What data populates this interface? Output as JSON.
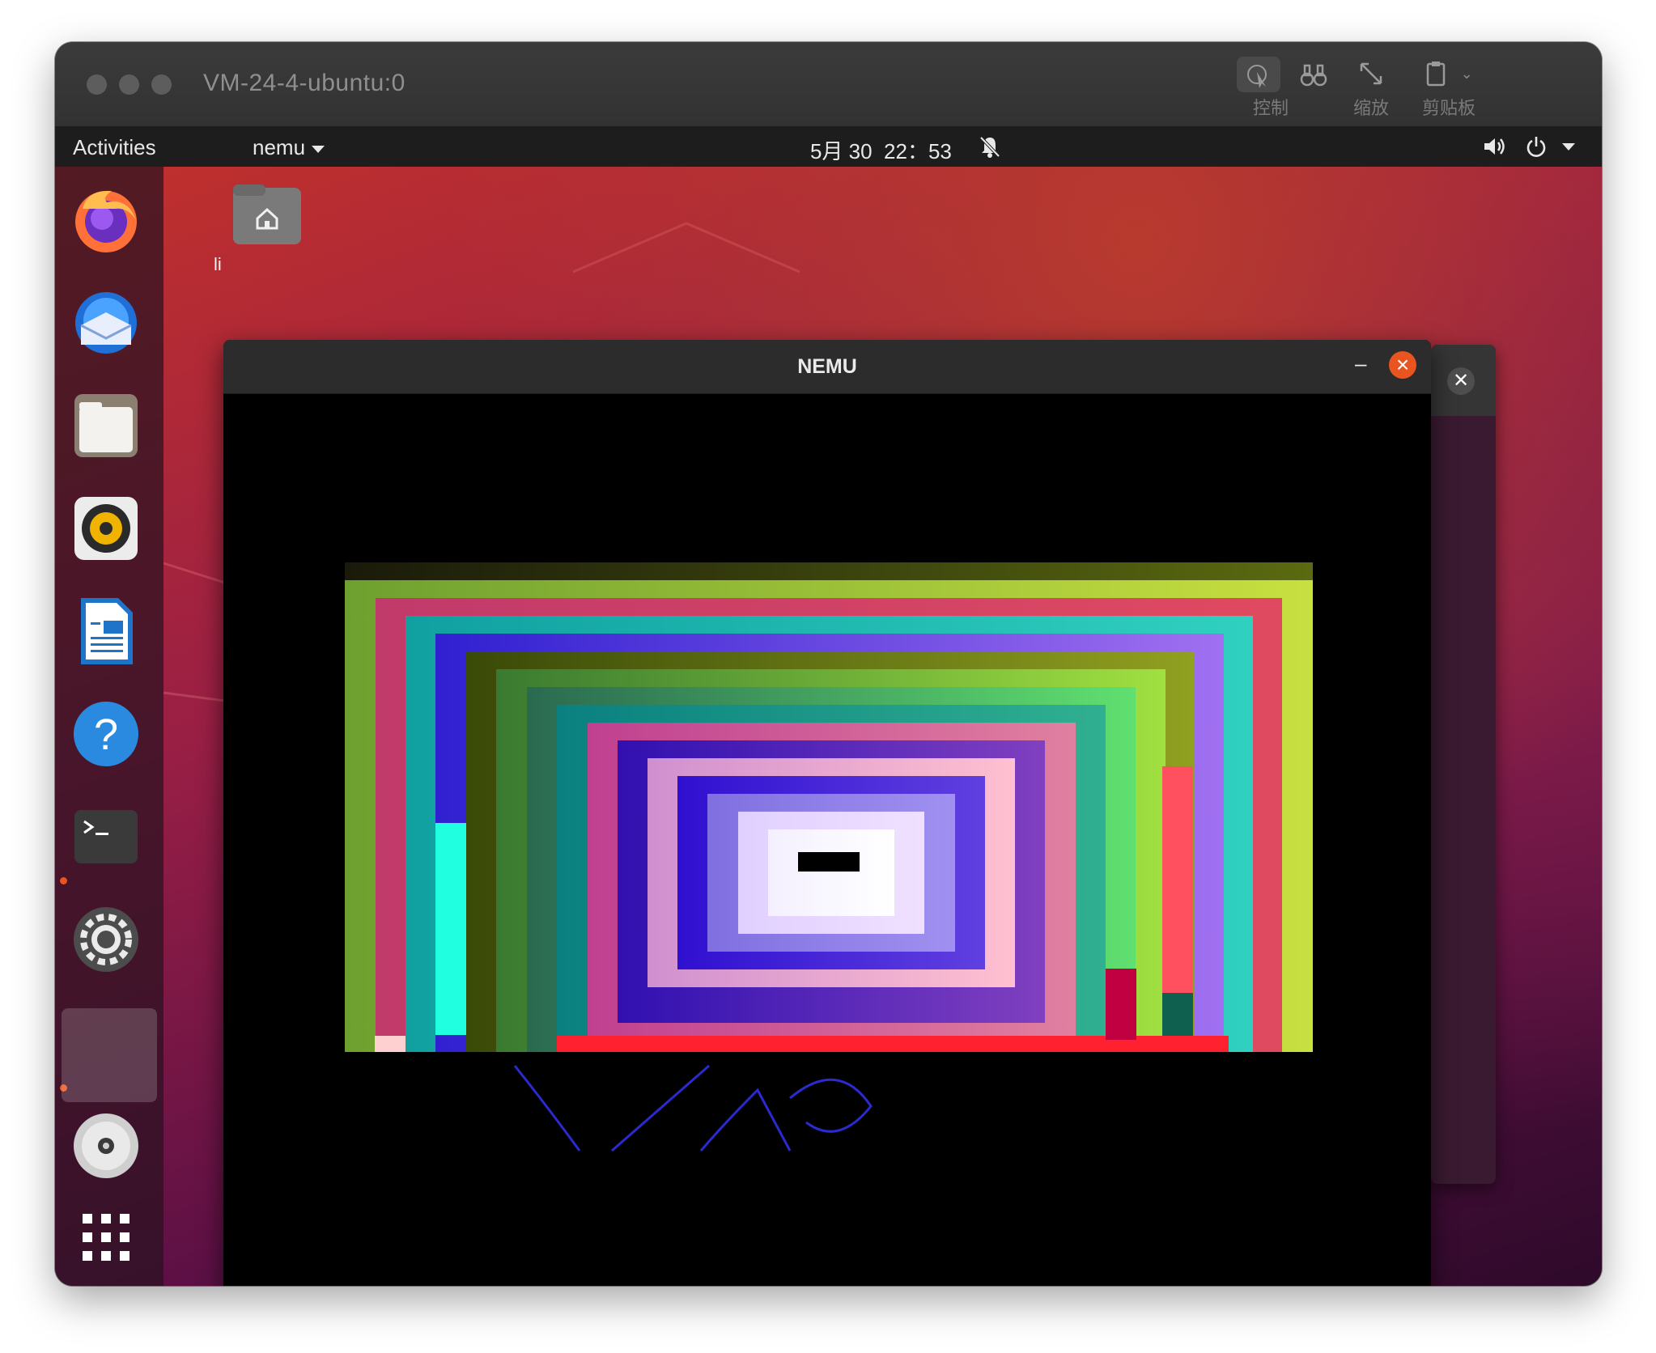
{
  "mac_window": {
    "title": "VM-24-4-ubuntu:0",
    "toolbar": [
      {
        "label": "控制",
        "icon": "pointer-control-icon"
      },
      {
        "label": "缩放",
        "icon": "resize-arrows-icon"
      },
      {
        "label": "剪贴板",
        "icon": "clipboard-icon"
      }
    ]
  },
  "ubuntu": {
    "topbar": {
      "activities": "Activities",
      "app_menu": "nemu",
      "clock": "5月 30  22：53"
    },
    "desktop": {
      "home_folder_label": "li"
    },
    "dock": [
      {
        "name": "firefox-icon"
      },
      {
        "name": "thunderbird-icon"
      },
      {
        "name": "files-icon"
      },
      {
        "name": "rhythmbox-icon"
      },
      {
        "name": "libreoffice-writer-icon"
      },
      {
        "name": "help-icon"
      },
      {
        "name": "terminal-icon"
      },
      {
        "name": "settings-icon"
      },
      {
        "name": "running-app-icon"
      },
      {
        "name": "dvd-icon"
      },
      {
        "name": "show-apps-icon"
      }
    ]
  },
  "nemu_window": {
    "title": "NEMU",
    "minimize": "–",
    "close": "×"
  },
  "colors": {
    "ubuntu_orange": "#e95420",
    "topbar": "#1d1d1d"
  }
}
